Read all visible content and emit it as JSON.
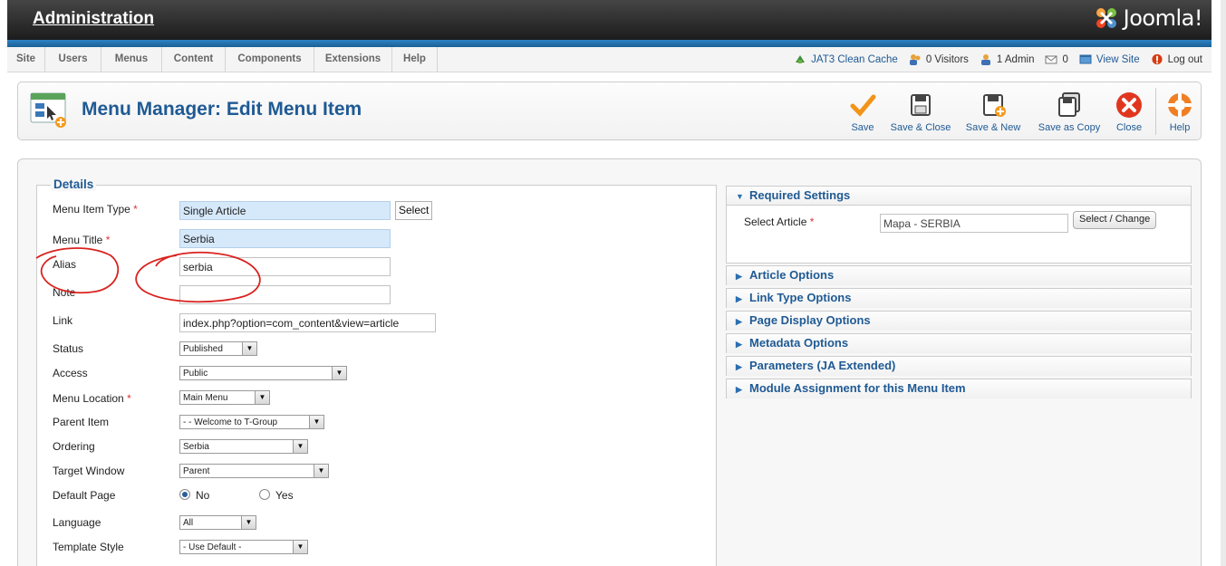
{
  "header": {
    "title": "Administration",
    "logo_text": "Joomla!"
  },
  "menu": {
    "items": [
      {
        "label": "Site"
      },
      {
        "label": "Users"
      },
      {
        "label": "Menus"
      },
      {
        "label": "Content"
      },
      {
        "label": "Components"
      },
      {
        "label": "Extensions"
      },
      {
        "label": "Help"
      }
    ]
  },
  "status": {
    "cache": "JAT3 Clean Cache",
    "visitors": "0 Visitors",
    "admins": "1 Admin",
    "messages": "0",
    "view_site": "View Site",
    "logout": "Log out"
  },
  "toolbar": {
    "page_title": "Menu Manager: Edit Menu Item",
    "save": "Save",
    "save_close": "Save & Close",
    "save_new": "Save & New",
    "save_copy": "Save as Copy",
    "close": "Close",
    "help": "Help"
  },
  "details": {
    "legend": "Details",
    "menu_item_type": {
      "label": "Menu Item Type",
      "value": "Single Article",
      "button": "Select"
    },
    "menu_title": {
      "label": "Menu Title",
      "value": "Serbia"
    },
    "alias": {
      "label": "Alias",
      "value": "serbia"
    },
    "note": {
      "label": "Note",
      "value": ""
    },
    "link": {
      "label": "Link",
      "value": "index.php?option=com_content&view=article"
    },
    "status": {
      "label": "Status",
      "value": "Published"
    },
    "access": {
      "label": "Access",
      "value": "Public"
    },
    "menu_location": {
      "label": "Menu Location",
      "value": "Main Menu"
    },
    "parent_item": {
      "label": "Parent Item",
      "value": "- - Welcome to T-Group"
    },
    "ordering": {
      "label": "Ordering",
      "value": "Serbia"
    },
    "target_window": {
      "label": "Target Window",
      "value": "Parent"
    },
    "default_page": {
      "label": "Default Page",
      "option_no": "No",
      "option_yes": "Yes",
      "selected": "No"
    },
    "language": {
      "label": "Language",
      "value": "All"
    },
    "template_style": {
      "label": "Template Style",
      "value": "- Use Default -"
    },
    "required_star": "*"
  },
  "right": {
    "required_settings": {
      "title": "Required Settings",
      "select_article_label": "Select Article",
      "select_article_value": "Mapa - SERBIA",
      "select_change": "Select / Change"
    },
    "panels": [
      "Article Options",
      "Link Type Options",
      "Page Display Options",
      "Metadata Options",
      "Parameters (JA Extended)",
      "Module Assignment for this Menu Item"
    ]
  },
  "colors": {
    "accent": "#1f5a94",
    "header_bar": "#1a5f96",
    "annotation": "#d9231f"
  },
  "icons": [
    "joomla-logo-icon",
    "cache-icon",
    "visitors-icon",
    "admin-icon",
    "messages-icon",
    "view-site-icon",
    "logout-icon",
    "menu-manager-icon",
    "save-icon",
    "save-close-icon",
    "save-new-icon",
    "save-copy-icon",
    "close-icon",
    "help-icon"
  ]
}
